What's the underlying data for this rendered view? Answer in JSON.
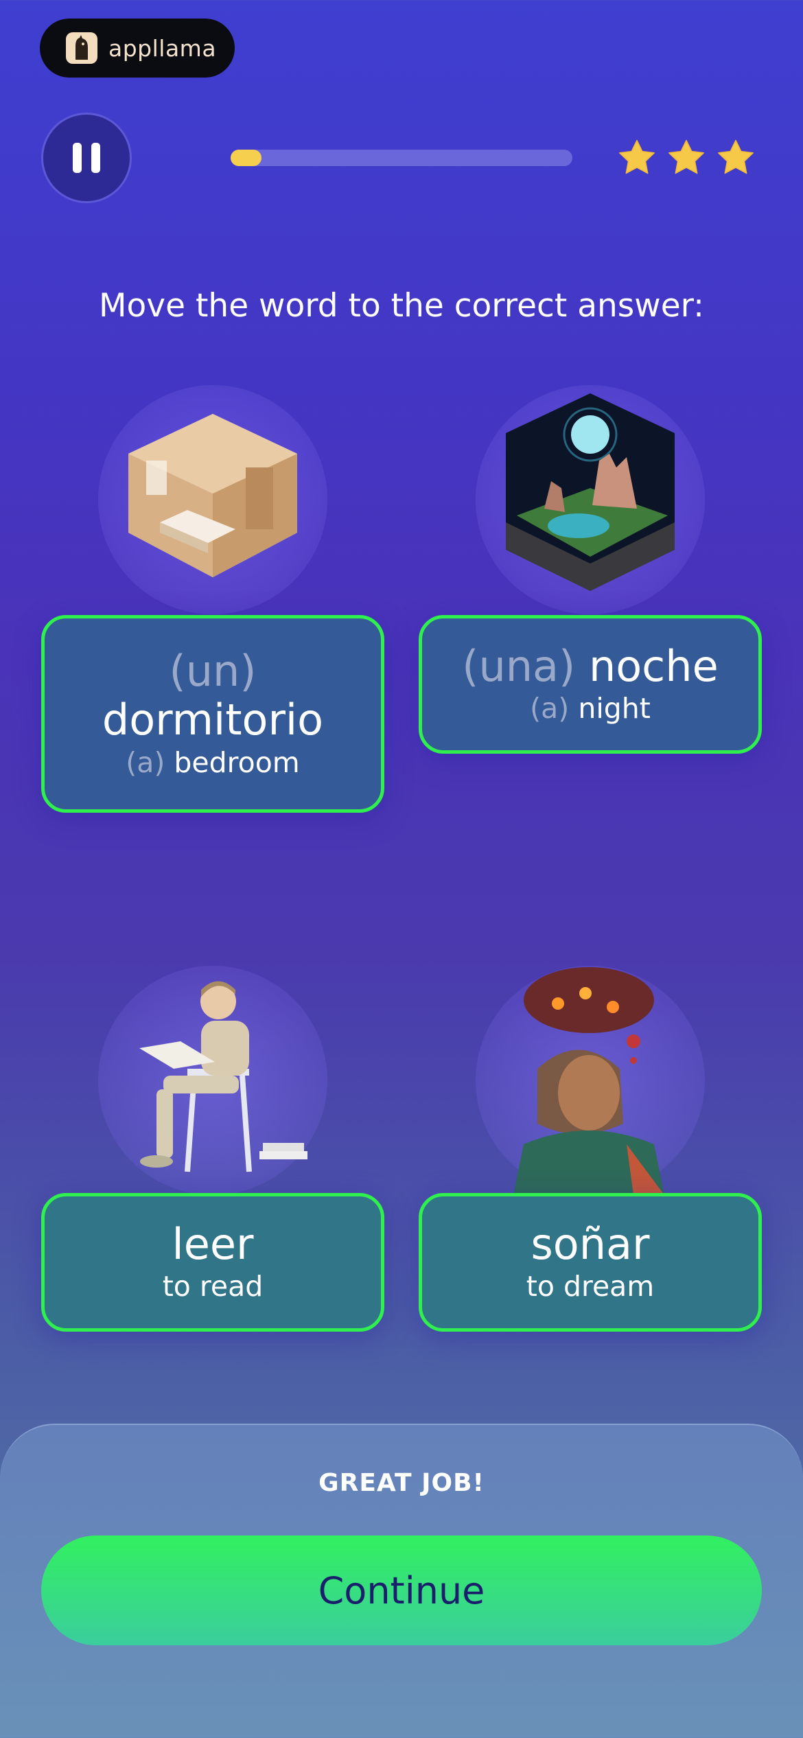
{
  "brand": {
    "name": "appllama",
    "logo_icon": "llama-icon"
  },
  "header": {
    "pause_icon": "pause-icon",
    "progress_percent": 9,
    "stars_count": 3,
    "star_color": "#f7cf4f"
  },
  "instruction": "Move the word to the correct answer:",
  "cards": [
    {
      "article": "(un)",
      "word": "dormitorio",
      "trans_article": "(a)",
      "translation": "bedroom",
      "image": "bedroom-illustration"
    },
    {
      "article": "(una)",
      "word": "noche",
      "trans_article": "(a)",
      "translation": "night",
      "image": "night-landscape-illustration"
    },
    {
      "article": "",
      "word": "leer",
      "trans_article": "",
      "translation": "to read",
      "image": "reading-boy-illustration"
    },
    {
      "article": "",
      "word": "soñar",
      "trans_article": "",
      "translation": "to dream",
      "image": "dreaming-woman-illustration"
    }
  ],
  "feedback": {
    "message": "GREAT JOB!",
    "continue_label": "Continue"
  },
  "colors": {
    "correct_border": "#2ff04f",
    "continue_button": "#32f05f",
    "continue_text": "#1a1f6b"
  }
}
